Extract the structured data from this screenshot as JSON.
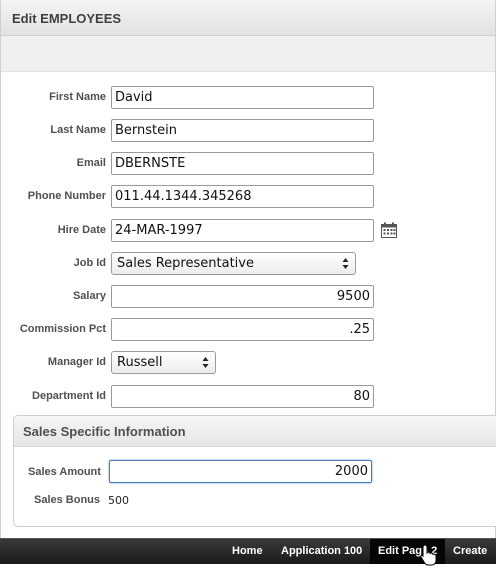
{
  "region": {
    "title": "Edit EMPLOYEES"
  },
  "form": {
    "first_name": {
      "label": "First Name",
      "value": "David"
    },
    "last_name": {
      "label": "Last Name",
      "value": "Bernstein"
    },
    "email": {
      "label": "Email",
      "value": "DBERNSTE"
    },
    "phone_number": {
      "label": "Phone Number",
      "value": "011.44.1344.345268"
    },
    "hire_date": {
      "label": "Hire Date",
      "value": "24-MAR-1997",
      "icon": "calendar-icon"
    },
    "job_id": {
      "label": "Job Id",
      "value": "Sales Representative"
    },
    "salary": {
      "label": "Salary",
      "value": "9500"
    },
    "commission_pct": {
      "label": "Commission Pct",
      "value": ".25"
    },
    "manager_id": {
      "label": "Manager Id",
      "value": "Russell"
    },
    "department_id": {
      "label": "Department Id",
      "value": "80"
    }
  },
  "sales_region": {
    "title": "Sales Specific Information",
    "sales_amount": {
      "label": "Sales Amount",
      "value": "2000"
    },
    "sales_bonus": {
      "label": "Sales Bonus",
      "value": "500"
    }
  },
  "developer_toolbar": {
    "items": [
      {
        "label": "Home"
      },
      {
        "label": "Application 100"
      },
      {
        "label": "Edit Page 2"
      },
      {
        "label": "Create"
      }
    ]
  },
  "colors": {
    "toolbar_bg": "#1a1a1a",
    "focus_border": "#4a78c2",
    "label_text": "#505050"
  }
}
